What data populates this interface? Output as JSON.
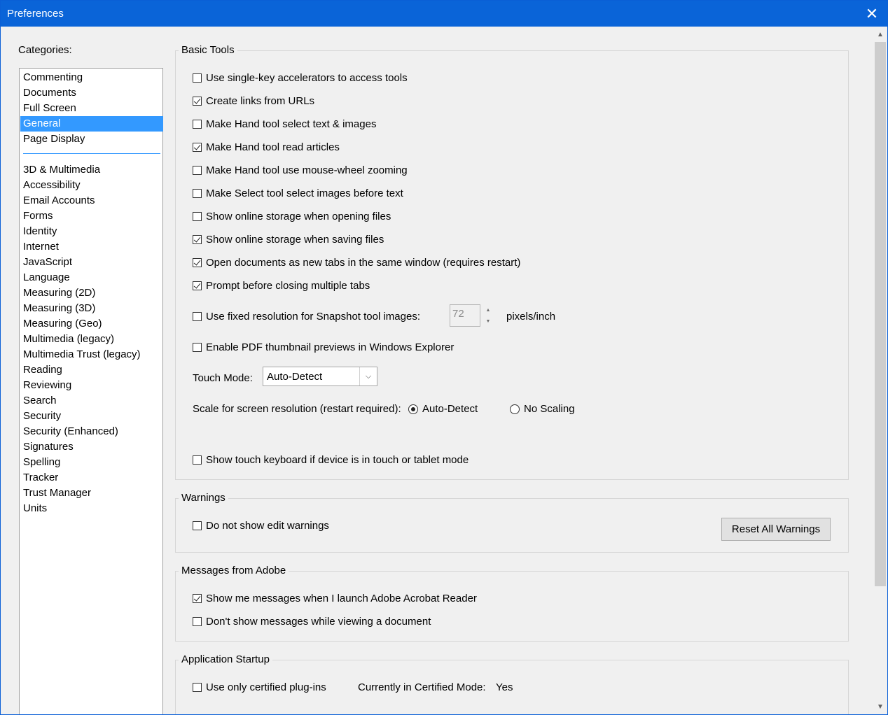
{
  "window": {
    "title": "Preferences",
    "close_glyph": "✕"
  },
  "categories": {
    "label": "Categories:",
    "top_items": [
      "Commenting",
      "Documents",
      "Full Screen",
      "General",
      "Page Display"
    ],
    "selected": "General",
    "other_items": [
      "3D & Multimedia",
      "Accessibility",
      "Email Accounts",
      "Forms",
      "Identity",
      "Internet",
      "JavaScript",
      "Language",
      "Measuring (2D)",
      "Measuring (3D)",
      "Measuring (Geo)",
      "Multimedia (legacy)",
      "Multimedia Trust (legacy)",
      "Reading",
      "Reviewing",
      "Search",
      "Security",
      "Security (Enhanced)",
      "Signatures",
      "Spelling",
      "Tracker",
      "Trust Manager",
      "Units"
    ]
  },
  "basic_tools": {
    "title": "Basic Tools",
    "options": [
      {
        "label": "Use single-key accelerators to access tools",
        "checked": false
      },
      {
        "label": "Create links from URLs",
        "checked": true
      },
      {
        "label": "Make Hand tool select text & images",
        "checked": false
      },
      {
        "label": "Make Hand tool read articles",
        "checked": true
      },
      {
        "label": "Make Hand tool use mouse-wheel zooming",
        "checked": false
      },
      {
        "label": "Make Select tool select images before text",
        "checked": false
      },
      {
        "label": "Show online storage when opening files",
        "checked": false
      },
      {
        "label": "Show online storage when saving files",
        "checked": true
      },
      {
        "label": "Open documents as new tabs in the same window (requires restart)",
        "checked": true
      },
      {
        "label": "Prompt before closing multiple tabs",
        "checked": true
      }
    ],
    "snapshot": {
      "label": "Use fixed resolution for Snapshot tool images:",
      "checked": false,
      "value": "72",
      "unit": "pixels/inch"
    },
    "thumbnail": {
      "label": "Enable PDF thumbnail previews in Windows Explorer",
      "checked": false
    },
    "touch_mode": {
      "label": "Touch Mode:",
      "value": "Auto-Detect"
    },
    "scale": {
      "label": "Scale for screen resolution (restart required):",
      "option1": "Auto-Detect",
      "option2": "No Scaling",
      "selected": "Auto-Detect"
    },
    "touch_keyboard": {
      "label": "Show touch keyboard if device is in touch or tablet mode",
      "checked": false
    }
  },
  "warnings": {
    "title": "Warnings",
    "option": {
      "label": "Do not show edit warnings",
      "checked": false
    },
    "reset_button": "Reset All Warnings"
  },
  "messages": {
    "title": "Messages from Adobe",
    "options": [
      {
        "label": "Show me messages when I launch Adobe Acrobat Reader",
        "checked": true
      },
      {
        "label": "Don't show messages while viewing a document",
        "checked": false
      }
    ]
  },
  "startup": {
    "title": "Application Startup",
    "option": {
      "label": "Use only certified plug-ins",
      "checked": false
    },
    "mode_label": "Currently in Certified Mode:",
    "mode_value": "Yes"
  }
}
